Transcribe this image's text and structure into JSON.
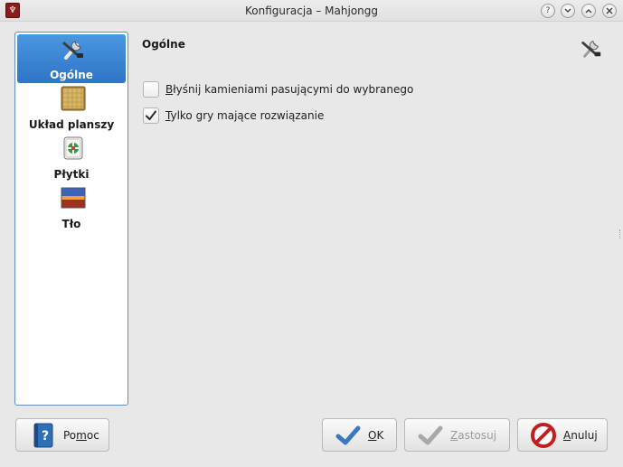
{
  "window": {
    "title": "Konfiguracja – Mahjongg",
    "app_icon_glyph": "♆",
    "controls": {
      "help": "help-icon",
      "minimize": "chevron-down-icon",
      "maximize": "chevron-up-icon",
      "close": "close-icon"
    }
  },
  "sidebar": {
    "items": [
      {
        "label": "Ogólne",
        "icon": "tools-icon",
        "selected": true
      },
      {
        "label": "Układ planszy",
        "icon": "board-layout-icon",
        "selected": false
      },
      {
        "label": "Płytki",
        "icon": "tiles-icon",
        "selected": false
      },
      {
        "label": "Tło",
        "icon": "background-image-icon",
        "selected": false
      }
    ]
  },
  "page": {
    "title": "Ogólne",
    "options": [
      {
        "pre": "",
        "accel": "B",
        "rest": "łyśnij kamieniami pasującymi do wybranego",
        "checked": false
      },
      {
        "pre": "",
        "accel": "T",
        "rest": "ylko gry mające rozwiązanie",
        "checked": true
      }
    ]
  },
  "buttons": {
    "help": {
      "pre": "Po",
      "accel": "m",
      "rest": "oc"
    },
    "ok": {
      "pre": "",
      "accel": "O",
      "rest": "K"
    },
    "apply": {
      "pre": "",
      "accel": "Z",
      "rest": "astosuj",
      "enabled": false
    },
    "cancel": {
      "pre": "",
      "accel": "A",
      "rest": "nuluj"
    }
  },
  "colors": {
    "selection": "#3b86d6",
    "ok_check": "#3a78c0",
    "cancel_red": "#d42020"
  }
}
